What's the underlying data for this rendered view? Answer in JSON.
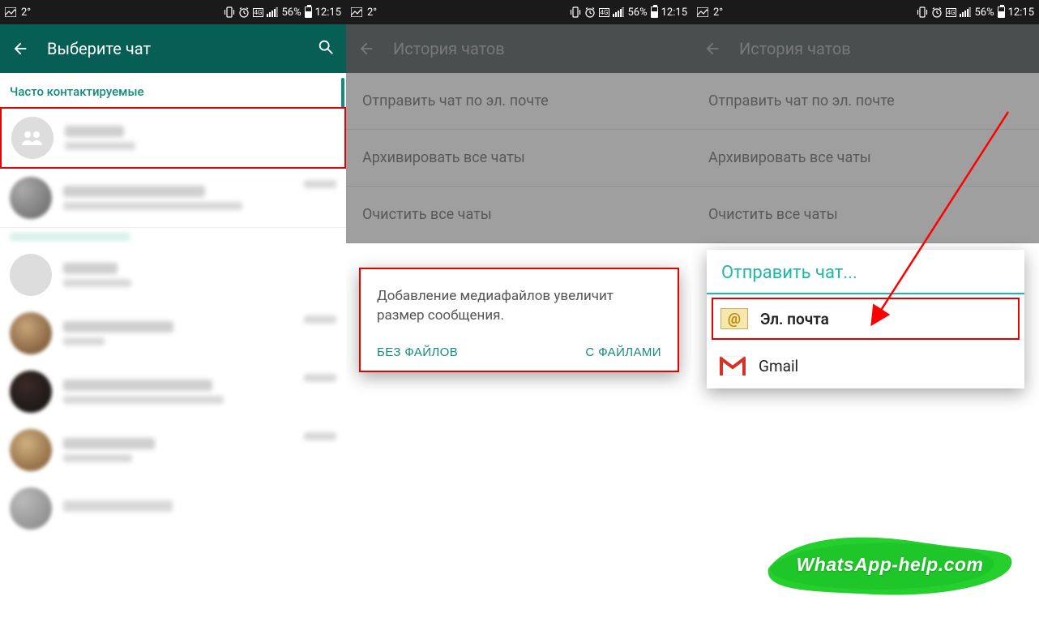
{
  "status": {
    "temp": "2°",
    "battery_pct": "56%",
    "time": "12:15",
    "net_label": "4G"
  },
  "panel1": {
    "title": "Выберите чат",
    "section": "Часто контактируемые"
  },
  "panel2": {
    "title": "История чатов",
    "options": {
      "email": "Отправить чат по эл. почте",
      "archive": "Архивировать все чаты",
      "clear": "Очистить все чаты"
    },
    "dialog_text": "Добавление медиафайлов увеличит размер сообщения.",
    "btn_no_files": "БЕЗ ФАЙЛОВ",
    "btn_with_files": "С ФАЙЛАМИ"
  },
  "panel3": {
    "title": "История чатов",
    "options": {
      "email": "Отправить чат по эл. почте",
      "archive": "Архивировать все чаты",
      "clear": "Очистить все чаты"
    },
    "share_title": "Отправить чат...",
    "share_email": "Эл. почта",
    "share_gmail": "Gmail"
  },
  "watermark": "WhatsApp-help.com"
}
